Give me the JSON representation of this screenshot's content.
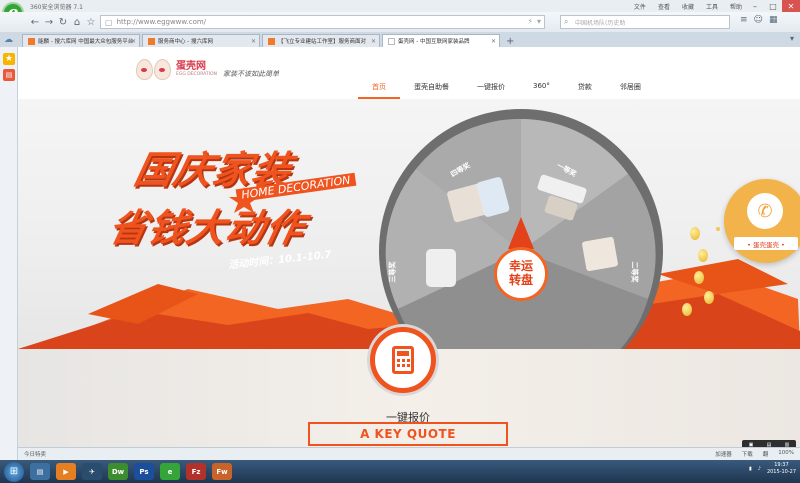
{
  "browser": {
    "title": "360安全浏览器 7.1",
    "menus": [
      "文件",
      "查看",
      "收藏",
      "工具",
      "帮助"
    ],
    "url": "http://www.eggwww.com/",
    "search_placeholder": "中国机场队(历史助",
    "tabs": [
      {
        "label": "能麟 - 搜六库网 中国最大众包服务平台",
        "active": false
      },
      {
        "label": "服务商中心 - 搜六库网",
        "active": false
      },
      {
        "label": "【飞立专业建站工作室】服务商面对",
        "active": false
      },
      {
        "label": "蛋壳网 - 中国互联网家装品牌",
        "active": true
      }
    ],
    "status_left": "今日特卖",
    "status_right": [
      "加速器",
      "下载",
      "翻",
      "100%"
    ]
  },
  "site": {
    "logo_name": "蛋壳网",
    "logo_sub": "EGG DECORATION",
    "slogan": "家装不该如此简单",
    "nav": [
      {
        "label": "首页",
        "active": true
      },
      {
        "label": "蛋壳自助餐",
        "active": false
      },
      {
        "label": "一键报价",
        "active": false
      },
      {
        "label": "360°",
        "active": false
      },
      {
        "label": "贷款",
        "active": false
      },
      {
        "label": "邻居圈",
        "active": false
      }
    ]
  },
  "banner": {
    "headline1": "国庆家装",
    "headline2": "省钱大动作",
    "english": "HOME DECORATION",
    "activity_time": "活动时间：10.1-10.7",
    "wheel_line1": "幸运",
    "wheel_line2": "转盘",
    "segments": [
      "四等奖",
      "一等奖",
      "三等奖",
      "二等奖"
    ],
    "phone_label": "• 蛋壳蛋壳 •"
  },
  "quote": {
    "title": "一键报价",
    "english": "A KEY QUOTE"
  },
  "taskbar": {
    "apps": [
      "Dw",
      "Ps",
      "Fz",
      "Fw"
    ],
    "time": "19:37",
    "date": "2015-10-27"
  },
  "colors": {
    "accent": "#f26522",
    "headline": "#f0531e",
    "brand_red": "#d8394b"
  }
}
